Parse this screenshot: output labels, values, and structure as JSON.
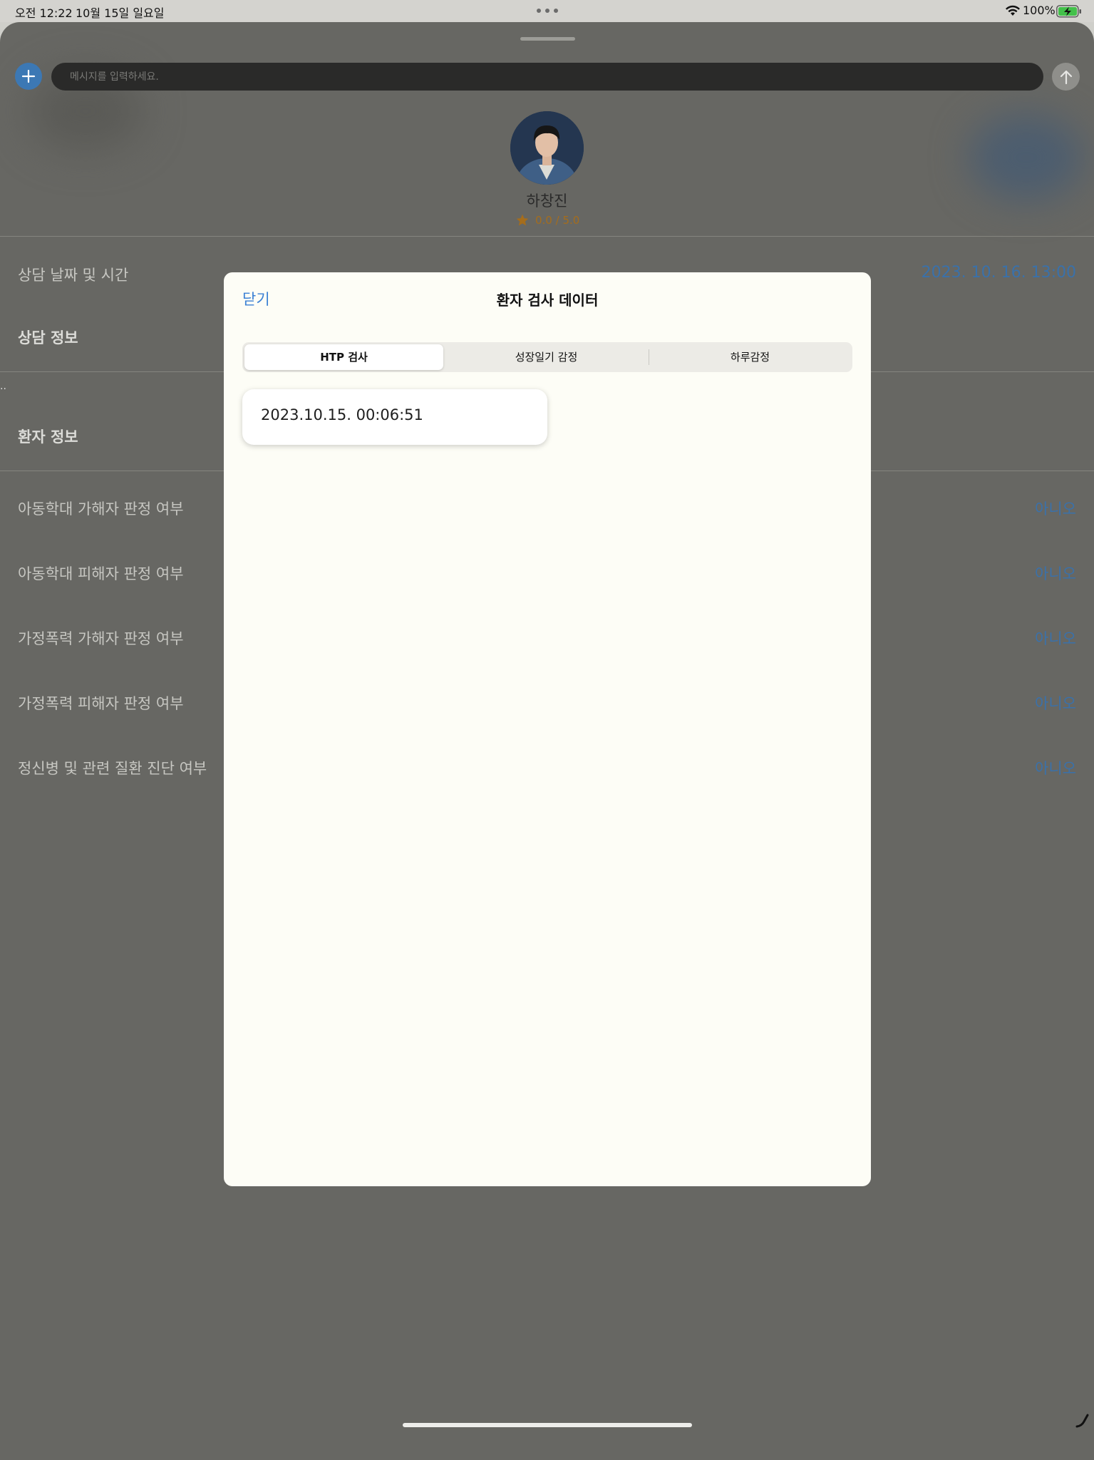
{
  "status_bar": {
    "time": "오전 12:22",
    "date": "10월 15일 일요일",
    "battery_percent": "100%",
    "battery_level": 1.0,
    "charging": true
  },
  "chat": {
    "add_icon": "plus-icon",
    "message_placeholder": "메시지를 입력하세요.",
    "send_icon": "arrow-up-icon"
  },
  "profile": {
    "name": "하창진",
    "rating_text": "0.0 / 5.0",
    "rating_icon": "star-icon"
  },
  "details": {
    "datetime_label": "상담 날짜 및 시간",
    "datetime_value": "2023. 10. 16. 13:00",
    "consult_info_title": "상담 정보",
    "patient_info_title": "환자 정보",
    "rows": [
      {
        "label": "아동학대 가해자 판정 여부",
        "value": "아니오"
      },
      {
        "label": "아동학대 피해자 판정 여부",
        "value": "아니오"
      },
      {
        "label": "가정폭력 가해자 판정 여부",
        "value": "아니오"
      },
      {
        "label": "가정폭력 피해자 판정 여부",
        "value": "아니오"
      },
      {
        "label": "정신병 및 관련 질환 진단 여부",
        "value": "아니오"
      }
    ]
  },
  "modal": {
    "close_label": "닫기",
    "title": "환자 검사 데이터",
    "tabs": [
      {
        "label": "HTP 검사",
        "selected": true
      },
      {
        "label": "성장일기 감정",
        "selected": false
      },
      {
        "label": "하루감정",
        "selected": false
      }
    ],
    "records": [
      {
        "timestamp": "2023.10.15. 00:06:51"
      }
    ]
  },
  "colors": {
    "accent_blue": "#3a80d4",
    "dim_value_blue": "#3a71aa",
    "modal_background": "#fdfdf6",
    "rating_orange": "#a56d1c"
  }
}
